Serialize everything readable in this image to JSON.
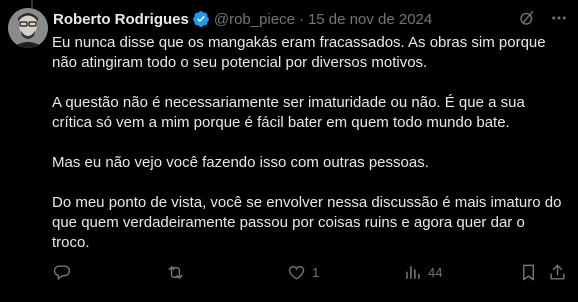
{
  "post": {
    "author_name": "Roberto Rodrigues",
    "handle": "@rob_piece",
    "separator": "·",
    "date": "15 de nov de 2024",
    "paragraphs": [
      "Eu nunca disse que os mangakás eram fracassados. As obras sim porque não atingiram todo o seu potencial por diversos motivos.",
      "A questão não é necessariamente ser imaturidade ou não. É que a sua crítica só vem a mim porque é fácil bater em quem todo mundo bate.",
      "Mas eu não vejo você fazendo isso com outras pessoas.",
      "Do meu ponto de vista, você se envolver nessa discussão é mais imaturo do que quem verdadeiramente passou por coisas ruins e agora quer dar o troco."
    ]
  },
  "actions": {
    "reply_count": "",
    "repost_count": "",
    "like_count": "1",
    "views_count": "44"
  },
  "icons": {
    "verified": "verified-badge-icon",
    "grok": "grok-icon",
    "more": "more-icon",
    "reply": "reply-icon",
    "repost": "repost-icon",
    "like": "like-icon",
    "views": "views-icon",
    "bookmark": "bookmark-icon",
    "share": "share-icon"
  },
  "colors": {
    "background": "#000000",
    "text": "#e7e9ea",
    "secondary": "#71767b",
    "verified": "#1d9bf0"
  }
}
